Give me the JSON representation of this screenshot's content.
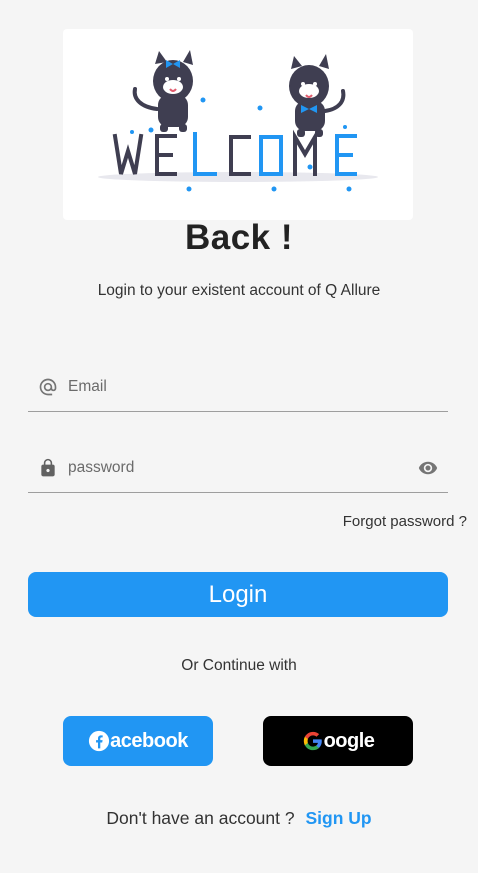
{
  "hero": {
    "illustration_text": "WELCOME",
    "colors": {
      "dark": "#3f3e51",
      "blue": "#2196f3"
    }
  },
  "header": {
    "title": "Back !",
    "subtitle": "Login to your existent account of Q Allure"
  },
  "form": {
    "email_placeholder": "Email",
    "email_value": "",
    "email_icon": "at-icon",
    "password_placeholder": "password",
    "password_value": "",
    "password_icon": "lock-icon",
    "visibility_icon": "eye-icon",
    "forgot_label": "Forgot password ?",
    "login_label": "Login"
  },
  "social": {
    "divider_text": "Or Continue with",
    "facebook_label": "acebook",
    "google_label": "oogle",
    "colors": {
      "facebook_bg": "#2196f3",
      "google_bg": "#000000"
    }
  },
  "footer": {
    "prompt": "Don't have an account ?",
    "signup_label": "Sign Up"
  },
  "theme": {
    "accent": "#2196f3",
    "background": "#f5f5f5"
  }
}
